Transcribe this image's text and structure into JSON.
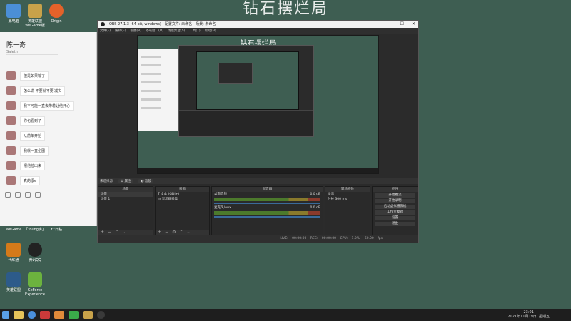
{
  "banner_title": "钻石摆烂局",
  "desktop_icons": {
    "top": [
      {
        "label": "此电脑",
        "color": "#4b8fd6"
      },
      {
        "label": "英雄联盟 WeGame版",
        "color": "#c8a24a"
      },
      {
        "label": "Origin",
        "color": "#e4622a"
      }
    ],
    "middle": [
      {
        "label": "WeGame",
        "color": "#e6e6e6"
      },
      {
        "label": "「Young房」",
        "color": "#e6e6e6"
      },
      {
        "label": "YY日粘",
        "color": "#e6e6e6"
      }
    ],
    "bottom": [
      {
        "label": "代练通",
        "color": "#d47a1a"
      },
      {
        "label": "腾讯QQ",
        "color": "#222222"
      },
      {
        "label": "英雄联盟",
        "color": "#2d5b8a"
      },
      {
        "label": "GeForce Experience",
        "color": "#6cb33e"
      }
    ]
  },
  "chat": {
    "name": "陈一奇",
    "subtitle": "Saleth",
    "messages": [
      "但是如果输了",
      "怎么讲 不要就不要 减实",
      "我不可能一直去带着让他开心",
      "你也看到了",
      "从前年开始",
      "我就一直企图",
      "把他拉出来",
      "真的很e"
    ]
  },
  "obs": {
    "title": "OBS 27.1.3 (64-bit, windows) - 配置文件: 未命名 - 场景: 未命名",
    "menu": [
      "文件(F)",
      "编辑(E)",
      "视图(V)",
      "停靠窗口(D)",
      "场景集合(S)",
      "工具(T)",
      "帮助(H)"
    ],
    "preview_title": "钻石摆烂局",
    "source_bar": {
      "label": "未选择源",
      "properties": "属性",
      "filters": "滤镜"
    },
    "docks": {
      "scenes": {
        "header": "场景",
        "items": [
          "场景",
          "场景 1"
        ]
      },
      "sources": {
        "header": "来源",
        "items": [
          "文本 (GDI+)",
          "显示器采集"
        ]
      },
      "mixer": {
        "header": "混音器",
        "tracks": [
          {
            "name": "桌面音频",
            "db": "0.0 dB"
          },
          {
            "name": "麦克风/Aux",
            "db": "0.0 dB"
          }
        ]
      },
      "transitions": {
        "header": "转场特效",
        "type": "淡出",
        "duration_label": "时长",
        "duration": "300 ms"
      },
      "controls": {
        "header": "控件",
        "buttons": [
          "开始推流",
          "开始录制",
          "启动虚拟摄像机",
          "工作室模式",
          "设置",
          "退出"
        ]
      }
    },
    "status": [
      "LIVE: 00:00:00",
      "REC: 00:00:00",
      "CPU: 1.0%, 60.00 fps"
    ]
  },
  "taskbar": {
    "time": "23:01",
    "date": "2021年11月19日, 星期五"
  }
}
